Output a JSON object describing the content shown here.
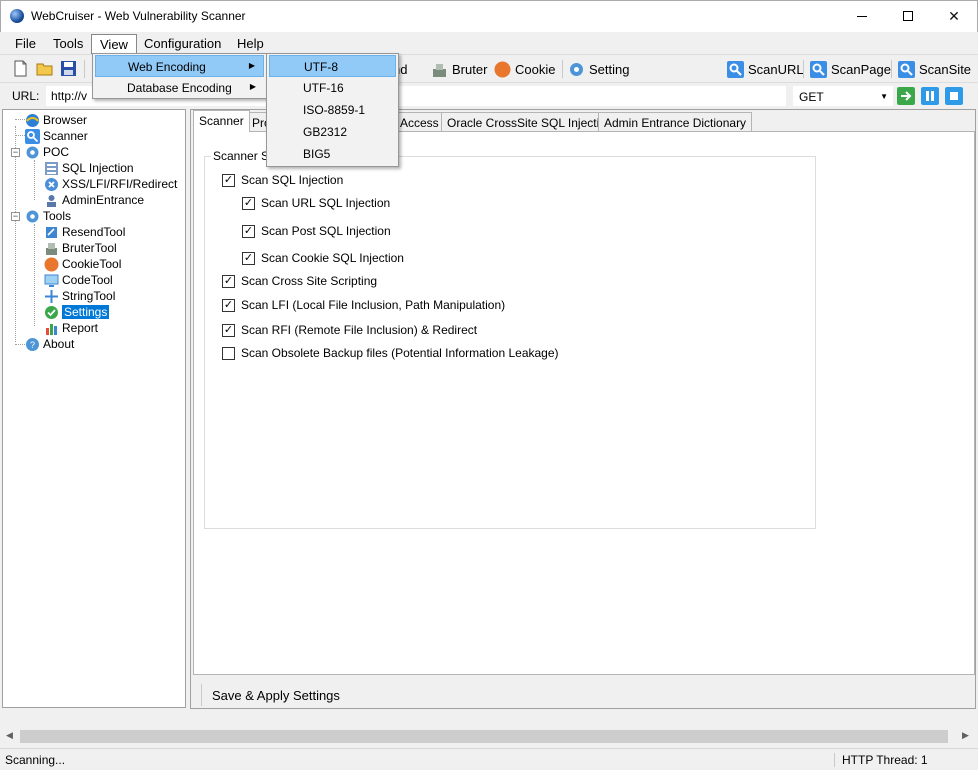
{
  "window": {
    "title": "WebCruiser - Web Vulnerability Scanner"
  },
  "menubar": [
    "File",
    "Tools",
    "View",
    "Configuration",
    "Help"
  ],
  "view_menu": {
    "items": [
      {
        "label": "Web Encoding",
        "has_submenu": true,
        "highlighted": true
      },
      {
        "label": "Database Encoding",
        "has_submenu": true,
        "highlighted": false
      }
    ]
  },
  "encoding_menu": {
    "items": [
      "UTF-8",
      "UTF-16",
      "ISO-8859-1",
      "GB2312",
      "BIG5"
    ],
    "highlighted": "UTF-8"
  },
  "toolbar": {
    "resend_label": "esend",
    "bruter_label": "Bruter",
    "cookie_label": "Cookie",
    "setting_label": "Setting",
    "scanurl_label": "ScanURL",
    "scanpage_label": "ScanPage",
    "scansite_label": "ScanSite"
  },
  "urlbar": {
    "label": "URL:",
    "value": "http://v",
    "method": "GET"
  },
  "tree": {
    "items": [
      {
        "label": "Browser",
        "icon": "globe-icon"
      },
      {
        "label": "Scanner",
        "icon": "scan-icon"
      },
      {
        "label": "POC",
        "icon": "gear-icon"
      },
      {
        "label": "SQL Injection",
        "icon": "database-icon"
      },
      {
        "label": "XSS/LFI/RFI/Redirect",
        "icon": "xss-icon"
      },
      {
        "label": "AdminEntrance",
        "icon": "admin-icon"
      },
      {
        "label": "Tools",
        "icon": "gear-icon"
      },
      {
        "label": "ResendTool",
        "icon": "resend-icon"
      },
      {
        "label": "BruterTool",
        "icon": "bruter-icon"
      },
      {
        "label": "CookieTool",
        "icon": "cookie-icon"
      },
      {
        "label": "CodeTool",
        "icon": "monitor-icon"
      },
      {
        "label": "StringTool",
        "icon": "string-icon"
      },
      {
        "label": "Settings",
        "icon": "check-circle-icon",
        "selected": true
      },
      {
        "label": "Report",
        "icon": "chart-icon"
      },
      {
        "label": "About",
        "icon": "info-icon"
      }
    ]
  },
  "tabs": [
    "Scanner",
    "Pro",
    "Access",
    "Oracle CrossSite SQL Injection",
    "Admin Entrance Dictionary"
  ],
  "scanner_settings": {
    "group_title": "Scanner Se",
    "options": [
      {
        "label": "Scan SQL Injection",
        "checked": true
      },
      {
        "label": "Scan URL SQL Injection",
        "checked": true
      },
      {
        "label": "Scan Post SQL Injection",
        "checked": true
      },
      {
        "label": "Scan Cookie SQL Injection",
        "checked": true
      },
      {
        "label": "Scan Cross Site Scripting",
        "checked": true
      },
      {
        "label": "Scan LFI (Local File Inclusion, Path Manipulation)",
        "checked": true
      },
      {
        "label": "Scan RFI (Remote File Inclusion) & Redirect",
        "checked": true
      },
      {
        "label": "Scan Obsolete Backup files (Potential Information Leakage)",
        "checked": false
      }
    ],
    "save_label": "Save & Apply Settings"
  },
  "statusbar": {
    "status": "Scanning...",
    "thread": "HTTP Thread: 1"
  },
  "colors": {
    "selection": "#0078d7",
    "menu_highlight": "#91c9f7"
  }
}
